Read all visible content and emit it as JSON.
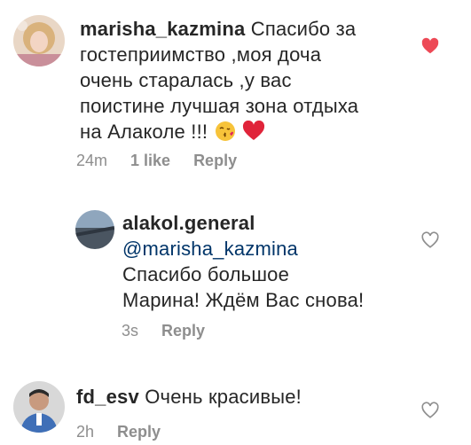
{
  "comments": [
    {
      "username": "marisha_kazmina",
      "text_lines": [
        "Спасибо за",
        "гостеприимство ,моя доча",
        "очень старалась ,у вас",
        "поистине лучшая зона отдыха",
        "на Алаколе !!!"
      ],
      "time": "24m",
      "likes": "1 like",
      "reply": "Reply",
      "liked": true,
      "emoji": [
        "kissing-face-icon",
        "red-heart-icon"
      ]
    },
    {
      "username": "alakol.general",
      "mention": "@marisha_kazmina",
      "text_lines": [
        "Спасибо большое",
        "Марина! Ждём Вас снова!"
      ],
      "time": "3s",
      "reply": "Reply",
      "liked": false
    },
    {
      "username": "fd_esv",
      "text": "Очень красивые!",
      "time": "2h",
      "reply": "Reply",
      "liked": false
    }
  ],
  "colors": {
    "text": "#262626",
    "meta": "#8e8e8e",
    "mention": "#003569",
    "like_active": "#ed4956"
  }
}
